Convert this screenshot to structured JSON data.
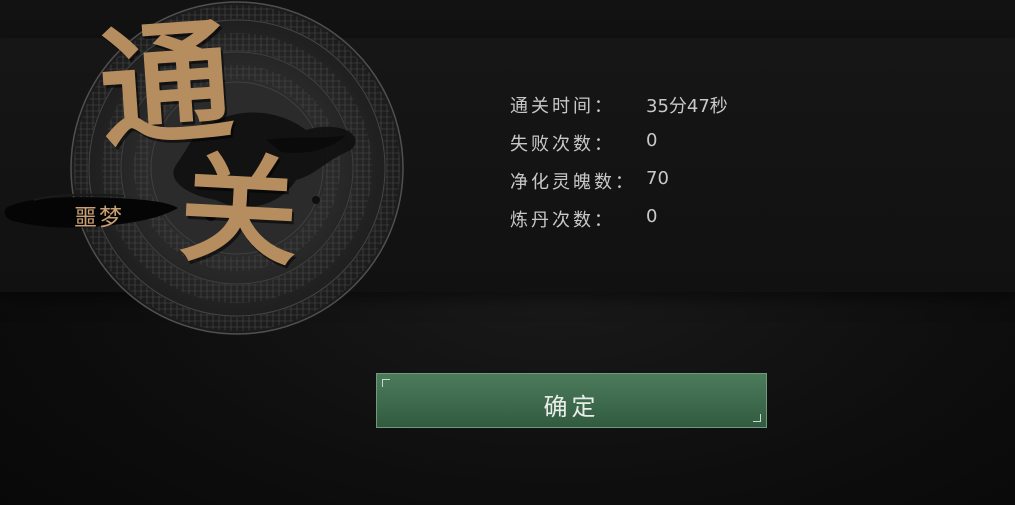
{
  "result": {
    "title_char_1": "通",
    "title_char_2": "关",
    "difficulty": "噩梦"
  },
  "stats": [
    {
      "label": "通关时间：",
      "value": "35分47秒"
    },
    {
      "label": "失败次数：",
      "value": "0"
    },
    {
      "label": "净化灵魄数：",
      "value": "70"
    },
    {
      "label": "炼丹次数：",
      "value": "0"
    }
  ],
  "actions": {
    "confirm_label": "确定"
  },
  "colors": {
    "title_gold": "#b58d5e",
    "button_green": "#3d6a4c",
    "stat_text": "#c8c8c8"
  }
}
